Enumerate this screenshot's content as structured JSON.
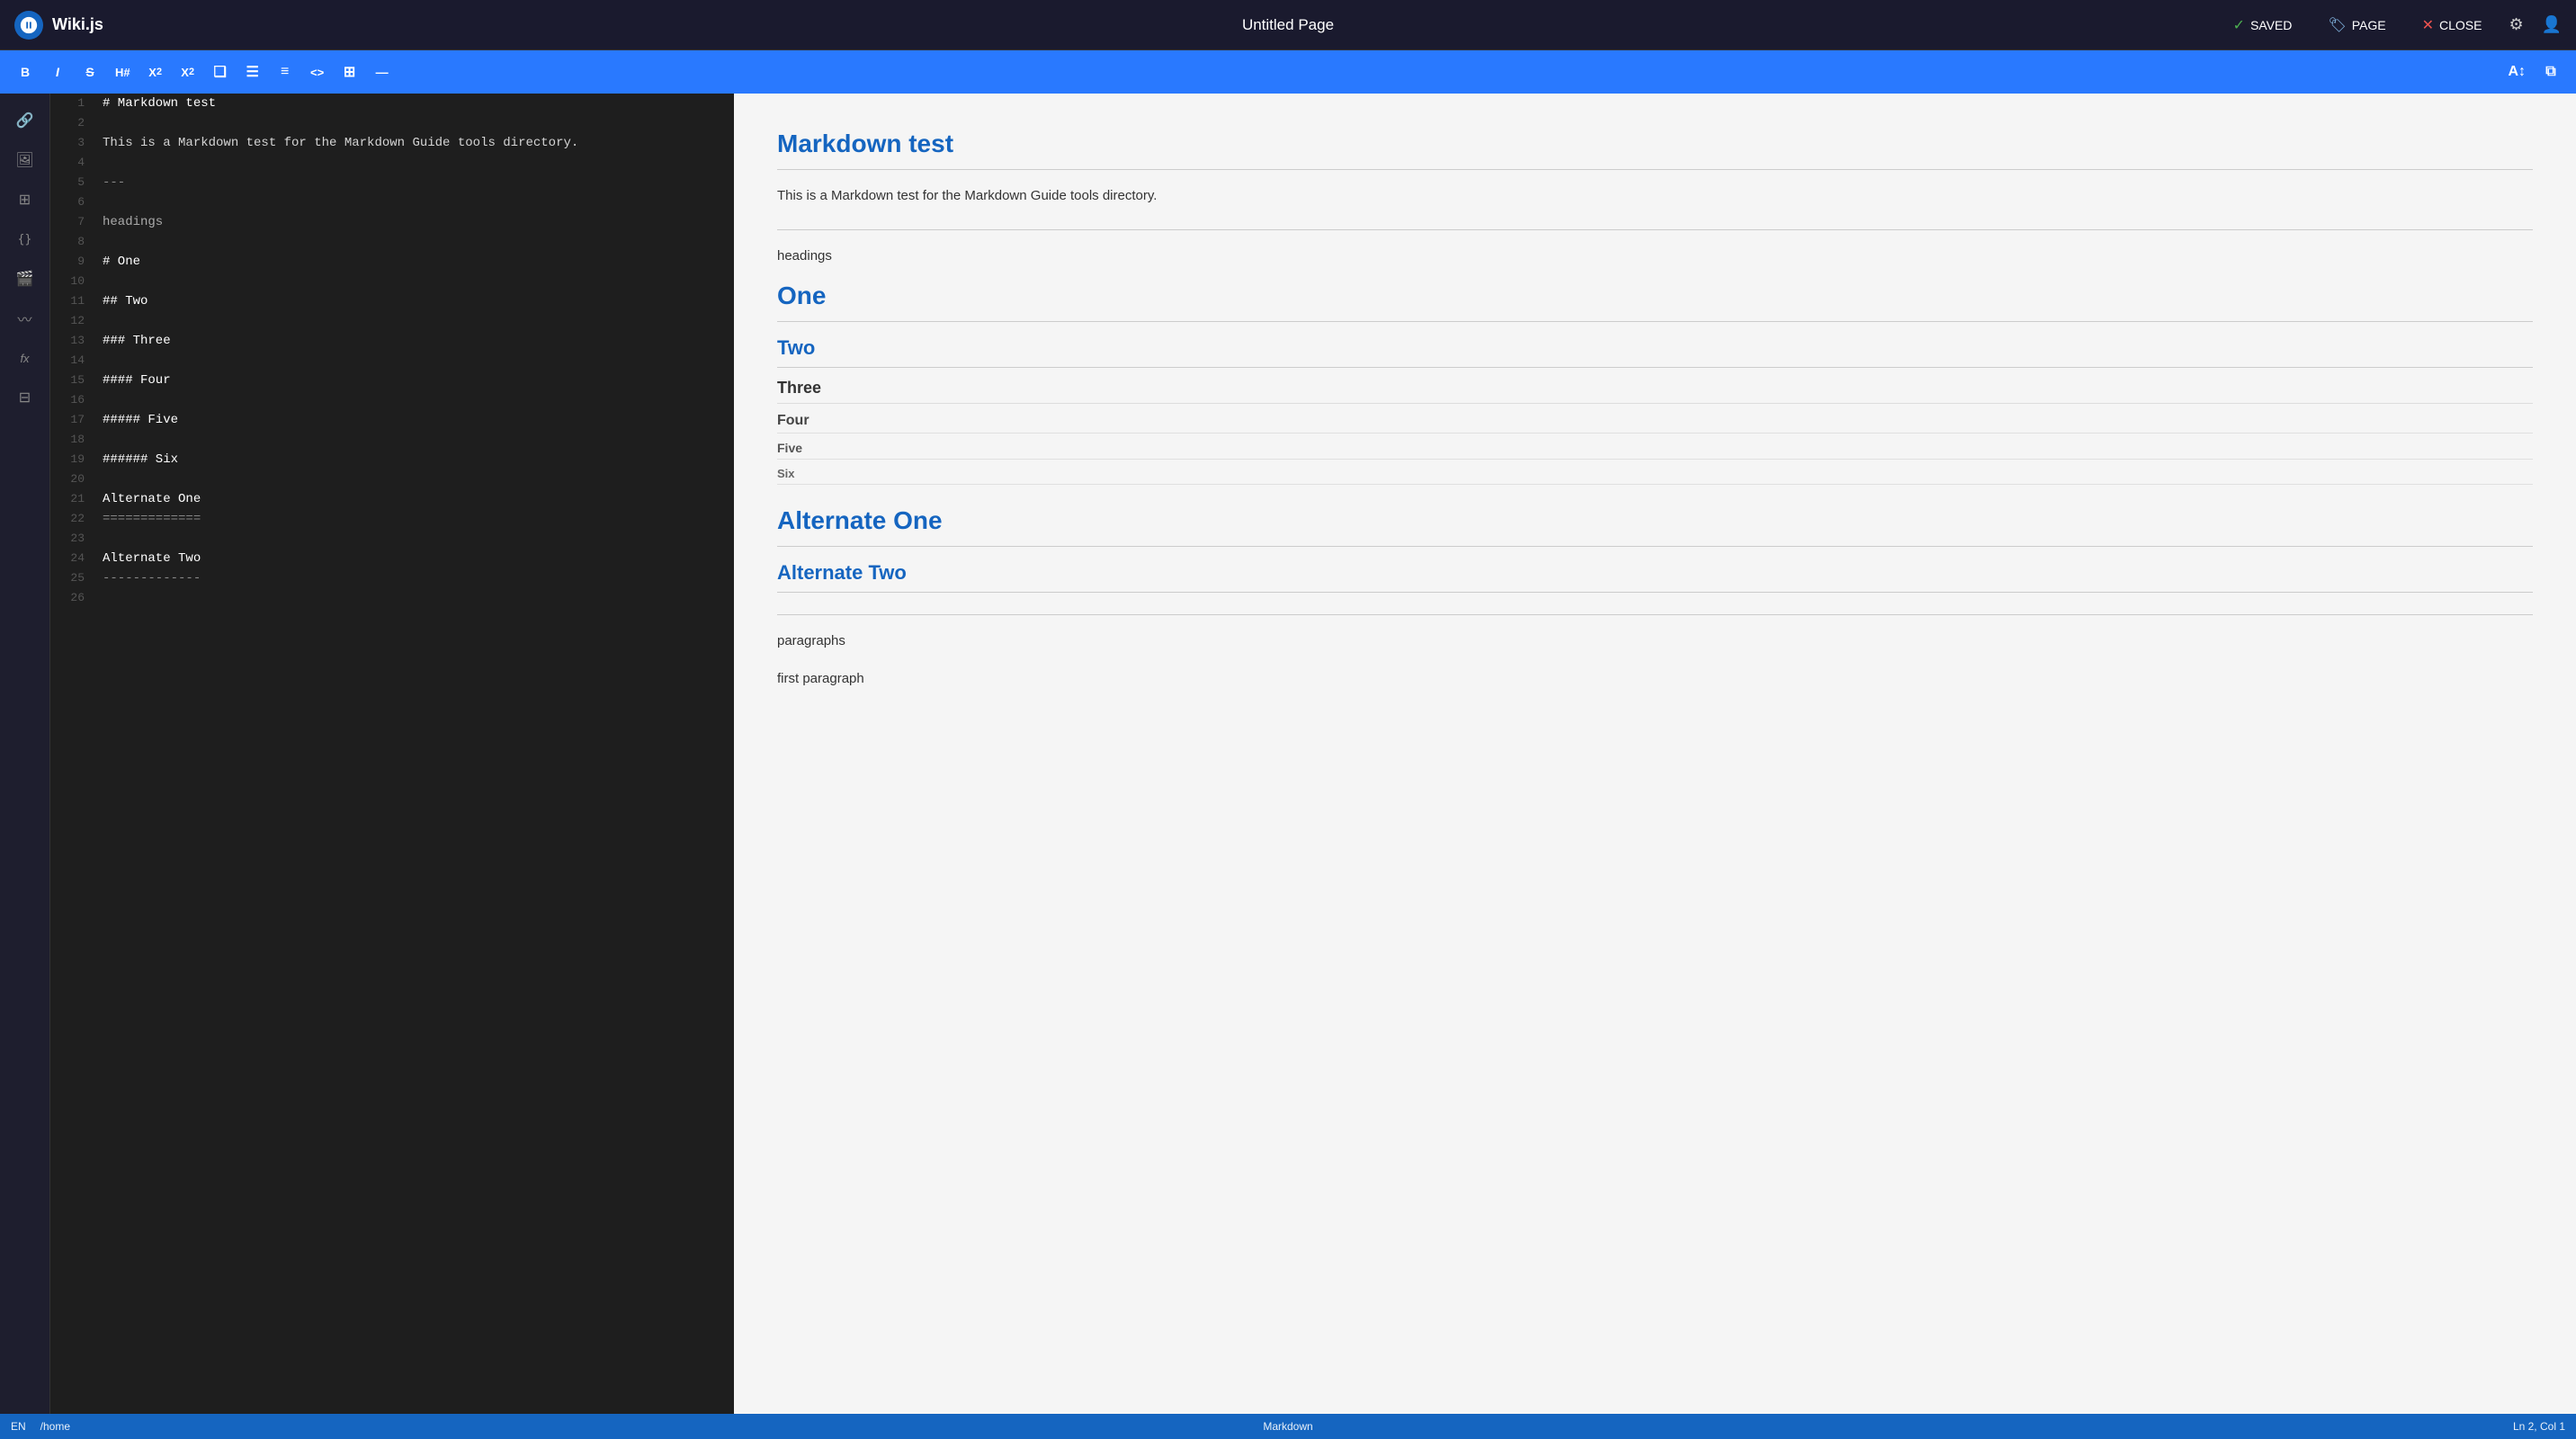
{
  "app": {
    "name": "Wiki.js"
  },
  "header": {
    "page_title": "Untitled Page",
    "saved_label": "SAVED",
    "page_label": "PAGE",
    "close_label": "CLOSE"
  },
  "toolbar": {
    "bold": "B",
    "italic": "I",
    "strikethrough": "S̶",
    "heading": "H#",
    "subscript": "X₂",
    "superscript": "X²",
    "blockquote": "❝",
    "ul": "☰",
    "ol": "≡",
    "code": "<>",
    "table": "⊞",
    "hr": "—"
  },
  "editor": {
    "lines": [
      {
        "num": "1",
        "content": "# Markdown test"
      },
      {
        "num": "2",
        "content": ""
      },
      {
        "num": "3",
        "content": "This is a Markdown test for the Markdown Guide tools directory."
      },
      {
        "num": "4",
        "content": ""
      },
      {
        "num": "5",
        "content": "---"
      },
      {
        "num": "6",
        "content": ""
      },
      {
        "num": "7",
        "content": "headings"
      },
      {
        "num": "8",
        "content": ""
      },
      {
        "num": "9",
        "content": "# One"
      },
      {
        "num": "10",
        "content": ""
      },
      {
        "num": "11",
        "content": "## Two"
      },
      {
        "num": "12",
        "content": ""
      },
      {
        "num": "13",
        "content": "### Three"
      },
      {
        "num": "14",
        "content": ""
      },
      {
        "num": "15",
        "content": "#### Four"
      },
      {
        "num": "16",
        "content": ""
      },
      {
        "num": "17",
        "content": "##### Five"
      },
      {
        "num": "18",
        "content": ""
      },
      {
        "num": "19",
        "content": "###### Six"
      },
      {
        "num": "20",
        "content": ""
      },
      {
        "num": "21",
        "content": "Alternate One"
      },
      {
        "num": "22",
        "content": "============="
      },
      {
        "num": "23",
        "content": ""
      },
      {
        "num": "24",
        "content": "Alternate Two"
      },
      {
        "num": "25",
        "content": "-------------"
      },
      {
        "num": "26",
        "content": ""
      }
    ]
  },
  "preview": {
    "h1": "Markdown test",
    "intro": "This is a Markdown test for the Markdown Guide tools directory.",
    "headings_label": "headings",
    "h1_one": "One",
    "h2_two": "Two",
    "h3_three": "Three",
    "h4_four": "Four",
    "h5_five": "Five",
    "h6_six": "Six",
    "alt_h1": "Alternate One",
    "alt_h2": "Alternate Two",
    "paragraphs_label": "paragraphs",
    "first_paragraph": "first paragraph"
  },
  "sidebar": {
    "items": [
      {
        "icon": "🔗",
        "name": "links-icon"
      },
      {
        "icon": "🖼",
        "name": "media-icon"
      },
      {
        "icon": "⊞",
        "name": "blocks-icon"
      },
      {
        "icon": "{}",
        "name": "code-icon"
      },
      {
        "icon": "🎬",
        "name": "video-icon"
      },
      {
        "icon": "〰",
        "name": "diagram-icon"
      },
      {
        "icon": "fx",
        "name": "math-icon"
      },
      {
        "icon": "⊟",
        "name": "embed-icon"
      }
    ]
  },
  "status_bar": {
    "language": "EN",
    "path": "/home",
    "mode": "Markdown",
    "cursor": "Ln 2, Col 1"
  }
}
